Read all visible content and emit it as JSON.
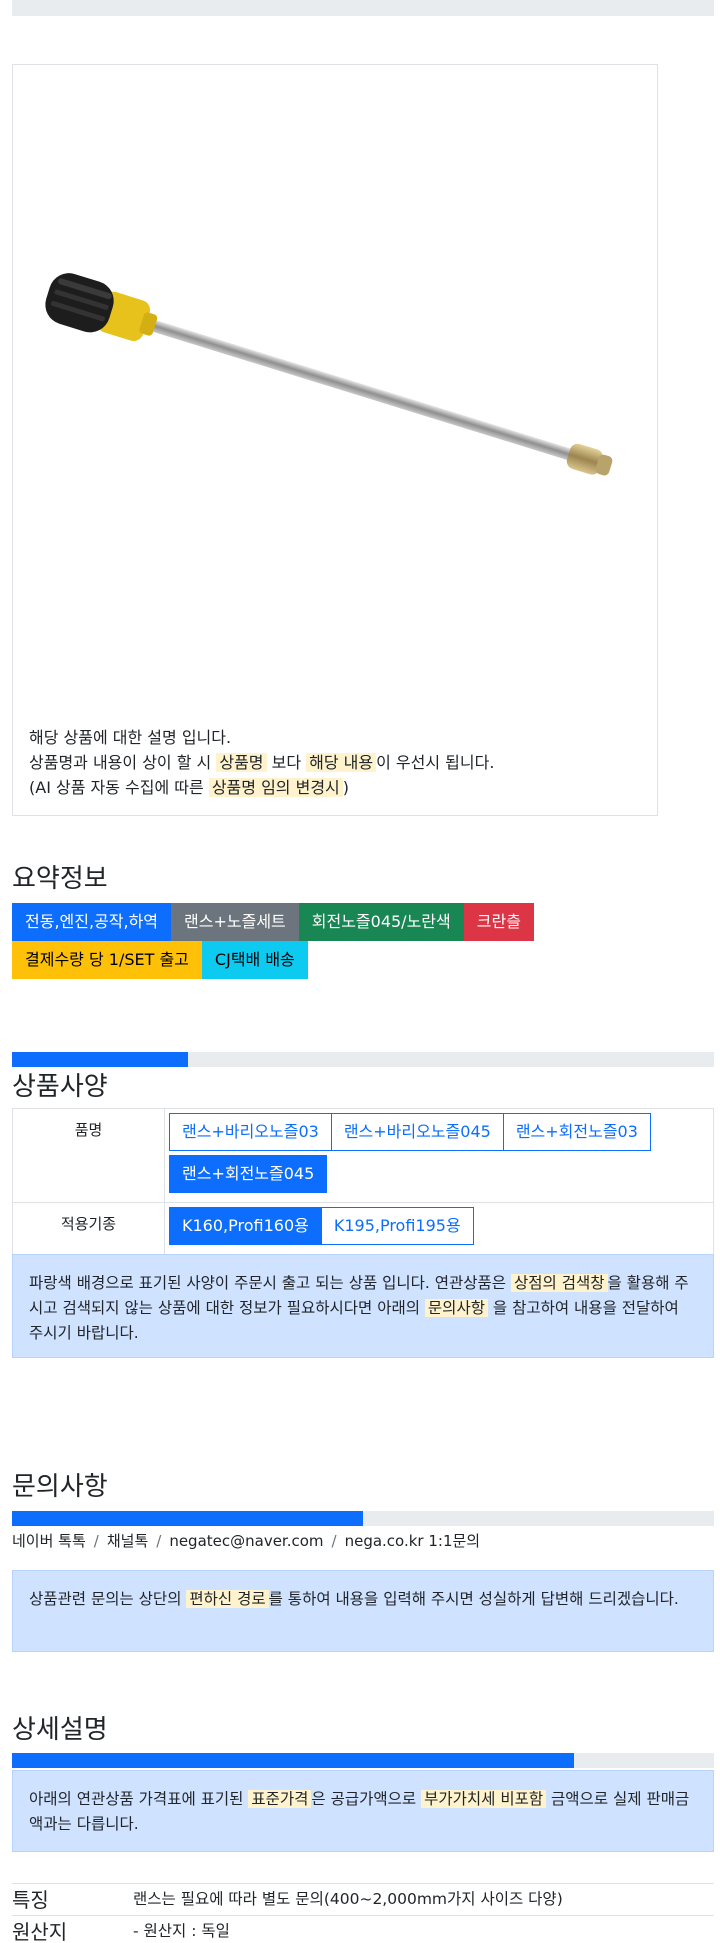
{
  "product_image": {
    "alt": "랜스 회전노즐"
  },
  "description": {
    "line1": "해당 상품에 대한 설명 입니다.",
    "line2_a": "상품명과 내용이 상이 할 시 ",
    "line2_mark1": "상품명",
    "line2_b": " 보다 ",
    "line2_mark2": "해당 내용",
    "line2_c": "이 우선시 됩니다.",
    "line3_a": "(AI 상품 자동 수집에 따른 ",
    "line3_mark": "상품명 임의 변경시",
    "line3_b": ")"
  },
  "summary": {
    "title": "요약정보",
    "badges": [
      "전동,엔진,공작,하역",
      "랜스+노즐세트",
      "회전노즐045/노란색",
      "크란츨",
      "결제수량 당 1/SET 출고",
      "CJ택배 배송"
    ]
  },
  "spec": {
    "title": "상품사양",
    "progress": 0.25,
    "rows": [
      {
        "label": "품명",
        "options": [
          "랜스+바리오노즐03",
          "랜스+바리오노즐045",
          "랜스+회전노즐03",
          "랜스+회전노즐045"
        ],
        "selected": 3
      },
      {
        "label": "적용기종",
        "options": [
          "K160,Profi160용",
          "K195,Profi195용"
        ],
        "selected": 0
      }
    ],
    "notice_a": "파랑색 배경으로 표기된 사양이 주문시 출고 되는 상품 입니다. 연관상품은 ",
    "notice_mark1": "상점의 검색창",
    "notice_b": "을 활용해 주시고 검색되지 않는 상품에 대한 정보가 필요하시다면 아래의 ",
    "notice_mark2": "문의사항",
    "notice_c": " 을 참고하여 내용을 전달하여 주시기 바랍니다."
  },
  "inquiry": {
    "title": "문의사항",
    "progress": 0.5,
    "links": [
      "네이버 톡톡",
      "채널톡",
      "negatec@naver.com",
      "nega.co.kr 1:1문의"
    ],
    "notice_a": "상품관련 문의는 상단의 ",
    "notice_mark": "편하신 경로",
    "notice_b": "를 통하여 내용을 입력해 주시면 성실하게 답변해 드리겠습니다."
  },
  "detail": {
    "title": "상세설명",
    "progress": 0.8,
    "notice_a": "아래의 연관상품 가격표에 표기된 ",
    "notice_mark1": "표준가격",
    "notice_b": "은 공급가액으로 ",
    "notice_mark2": "부가가치세 비포함",
    "notice_c": " 금액으로 실제 판매금액과는 다릅니다.",
    "rows": [
      {
        "key": "특징",
        "value": "랜스는 필요에 따라 별도 문의(400~2,000mm가지 사이즈 다양)"
      },
      {
        "key": "원산지",
        "value": "- 원산지 : 독일"
      }
    ]
  },
  "colors": {
    "primary": "#0d6efd",
    "highlight": "#fff3cd",
    "alert_bg": "#cfe2ff"
  }
}
